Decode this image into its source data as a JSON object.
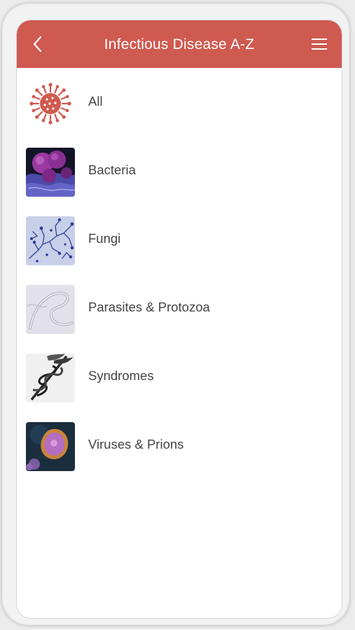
{
  "header": {
    "title": "Infectious Disease A-Z",
    "back_icon": "chevron-left-icon",
    "menu_icon": "hamburger-menu-icon",
    "color": "#cf5a50"
  },
  "categories": [
    {
      "label": "All",
      "icon": "virus-icon"
    },
    {
      "label": "Bacteria",
      "icon": "bacteria-image"
    },
    {
      "label": "Fungi",
      "icon": "fungi-image"
    },
    {
      "label": "Parasites & Protozoa",
      "icon": "parasites-image"
    },
    {
      "label": "Syndromes",
      "icon": "caduceus-image"
    },
    {
      "label": "Viruses & Prions",
      "icon": "virus-micrograph-image"
    }
  ]
}
